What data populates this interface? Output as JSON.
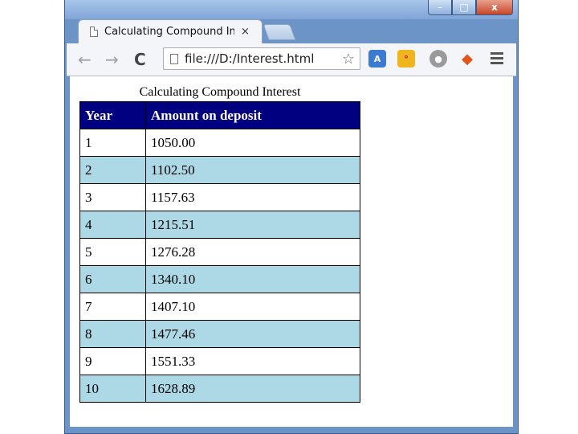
{
  "browser": {
    "tab_title": "Calculating Compound In",
    "tab_close": "×",
    "url": "file:///D:/Interest.html",
    "win_min": "–",
    "win_max": "□",
    "win_close": "x"
  },
  "page": {
    "caption": "Calculating Compound Interest",
    "headers": [
      "Year",
      "Amount on deposit"
    ],
    "rows": [
      [
        "1",
        "1050.00"
      ],
      [
        "2",
        "1102.50"
      ],
      [
        "3",
        "1157.63"
      ],
      [
        "4",
        "1215.51"
      ],
      [
        "5",
        "1276.28"
      ],
      [
        "6",
        "1340.10"
      ],
      [
        "7",
        "1407.10"
      ],
      [
        "8",
        "1477.46"
      ],
      [
        "9",
        "1551.33"
      ],
      [
        "10",
        "1628.89"
      ]
    ]
  },
  "colors": {
    "header_bg": "#000080",
    "alt_row_bg": "#add8e6"
  }
}
